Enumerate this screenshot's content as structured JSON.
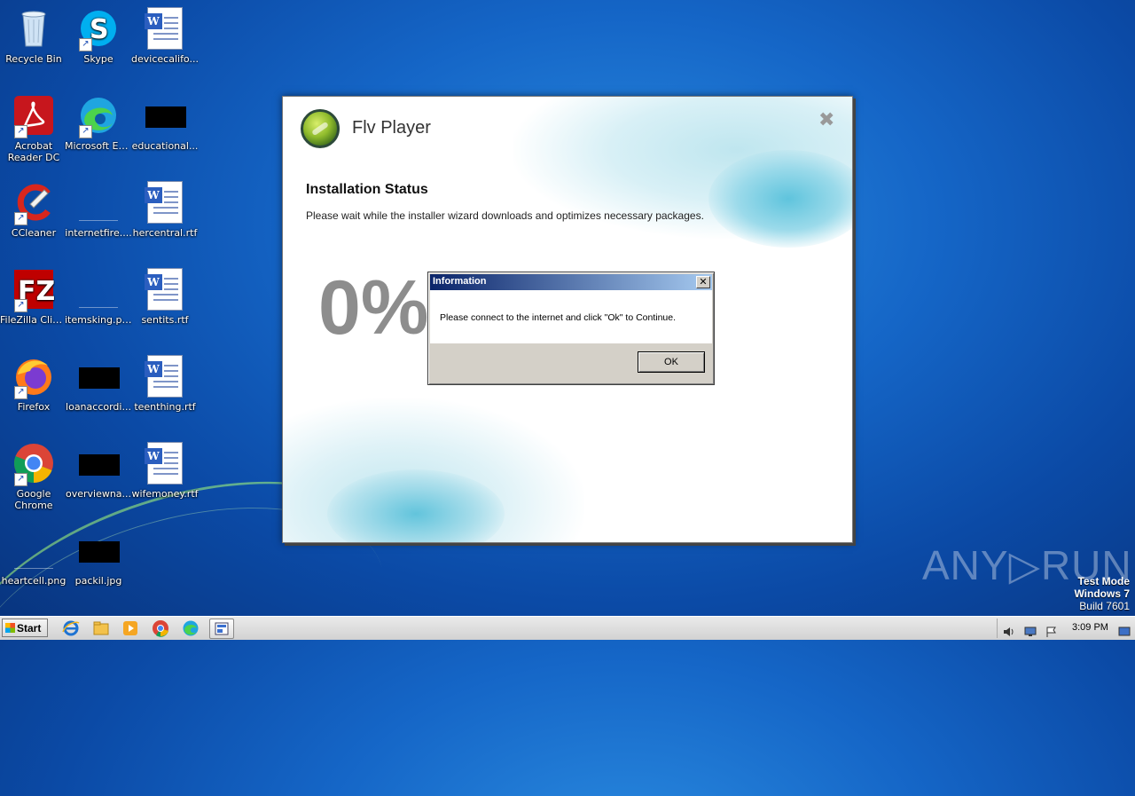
{
  "desktop": {
    "icons": [
      {
        "label": "Recycle Bin"
      },
      {
        "label": "Skype"
      },
      {
        "label": "devicecalifo..."
      },
      {
        "label": "Acrobat Reader DC"
      },
      {
        "label": "Microsoft Edge"
      },
      {
        "label": "educational..."
      },
      {
        "label": "CCleaner"
      },
      {
        "label": "internetfire...."
      },
      {
        "label": "hercentral.rtf"
      },
      {
        "label": "FileZilla Client"
      },
      {
        "label": "itemsking.png"
      },
      {
        "label": "sentits.rtf"
      },
      {
        "label": "Firefox"
      },
      {
        "label": "loanaccordi..."
      },
      {
        "label": "teenthing.rtf"
      },
      {
        "label": "Google Chrome"
      },
      {
        "label": "overviewna..."
      },
      {
        "label": "wifemoney.rtf"
      },
      {
        "label": "heartcell.png"
      },
      {
        "label": "packil.jpg"
      }
    ]
  },
  "installer": {
    "app_title": "Flv Player",
    "close_glyph": "✖",
    "status_title": "Installation Status",
    "status_desc": "Please wait while the installer wizard downloads and optimizes necessary packages.",
    "progress_text": "0%"
  },
  "dialog": {
    "title": "Information",
    "close_glyph": "✕",
    "message": "Please connect to the internet and click \"Ok\" to Continue.",
    "ok_label": "OK"
  },
  "watermark": {
    "text": "ANY▷RUN"
  },
  "system": {
    "test_mode": "Test Mode",
    "os_name": "Windows 7",
    "build": "Build 7601"
  },
  "taskbar": {
    "start_label": "Start",
    "clock": "3:09 PM"
  }
}
